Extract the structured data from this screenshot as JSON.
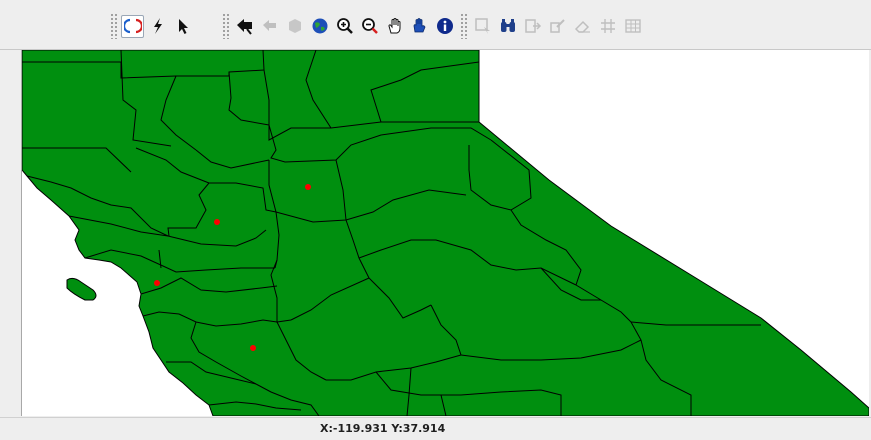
{
  "toolbar": {
    "groups": [
      {
        "name": "selection-tools",
        "buttons": [
          {
            "icon": "refresh-icon",
            "state": "selected"
          },
          {
            "icon": "lightning-icon",
            "state": "enabled"
          },
          {
            "icon": "pointer-arrow-icon",
            "state": "enabled"
          }
        ]
      },
      {
        "name": "navigation-tools",
        "buttons": [
          {
            "icon": "back-arrow-icon",
            "state": "enabled"
          },
          {
            "icon": "previous-extent-icon",
            "state": "disabled"
          },
          {
            "icon": "next-extent-icon",
            "state": "disabled"
          },
          {
            "icon": "globe-icon",
            "state": "enabled"
          },
          {
            "icon": "zoom-in-icon",
            "state": "enabled"
          },
          {
            "icon": "zoom-out-icon",
            "state": "enabled"
          },
          {
            "icon": "pan-hand-icon",
            "state": "enabled"
          },
          {
            "icon": "recenter-icon",
            "state": "enabled"
          },
          {
            "icon": "info-icon",
            "state": "enabled"
          }
        ]
      },
      {
        "name": "query-tools",
        "buttons": [
          {
            "icon": "select-features-icon",
            "state": "disabled"
          },
          {
            "icon": "binoculars-icon",
            "state": "enabled"
          },
          {
            "icon": "export-icon",
            "state": "disabled"
          },
          {
            "icon": "edit-layer-icon",
            "state": "disabled"
          },
          {
            "icon": "eraser-icon",
            "state": "disabled"
          },
          {
            "icon": "snap-grid-icon",
            "state": "disabled"
          },
          {
            "icon": "attribute-table-icon",
            "state": "disabled"
          }
        ]
      }
    ]
  },
  "map": {
    "colors": {
      "land_fill": "#008f0f",
      "boundary": "#000000",
      "point_marker": "#ff0000",
      "background": "#ffffff"
    },
    "point_markers": 4
  },
  "status": {
    "coordinates": "X:-119.931 Y:37.914"
  }
}
